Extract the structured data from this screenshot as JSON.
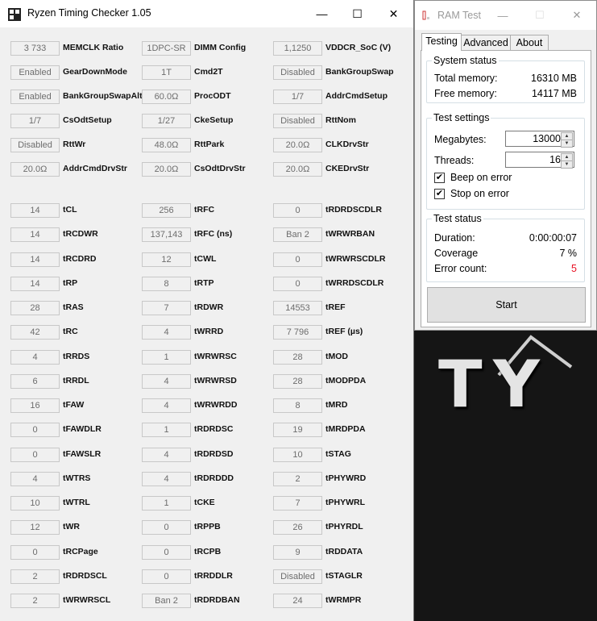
{
  "rtc": {
    "title": "Ryzen Timing Checker 1.05",
    "window_buttons": {
      "minimize": "—",
      "maximize": "☐",
      "close": "✕"
    },
    "columns": [
      [
        {
          "value": "3 733",
          "label": "MEMCLK Ratio"
        },
        {
          "value": "Enabled",
          "label": "GearDownMode"
        },
        {
          "value": "Enabled",
          "label": "BankGroupSwapAlt"
        },
        {
          "value": "1/7",
          "label": "CsOdtSetup"
        },
        {
          "value": "Disabled",
          "label": "RttWr"
        },
        {
          "value": "20.0Ω",
          "label": "AddrCmdDrvStr"
        },
        {
          "value": "14",
          "label": "tCL"
        },
        {
          "value": "14",
          "label": "tRCDWR"
        },
        {
          "value": "14",
          "label": "tRCDRD"
        },
        {
          "value": "14",
          "label": "tRP"
        },
        {
          "value": "28",
          "label": "tRAS"
        },
        {
          "value": "42",
          "label": "tRC"
        },
        {
          "value": "4",
          "label": "tRRDS"
        },
        {
          "value": "6",
          "label": "tRRDL"
        },
        {
          "value": "16",
          "label": "tFAW"
        },
        {
          "value": "0",
          "label": "tFAWDLR"
        },
        {
          "value": "0",
          "label": "tFAWSLR"
        },
        {
          "value": "4",
          "label": "tWTRS"
        },
        {
          "value": "10",
          "label": "tWTRL"
        },
        {
          "value": "12",
          "label": "tWR"
        },
        {
          "value": "0",
          "label": "tRCPage"
        },
        {
          "value": "2",
          "label": "tRDRDSCL"
        },
        {
          "value": "2",
          "label": "tWRWRSCL"
        }
      ],
      [
        {
          "value": "1DPC-SR",
          "label": "DIMM Config"
        },
        {
          "value": "1T",
          "label": "Cmd2T"
        },
        {
          "value": "60.0Ω",
          "label": "ProcODT"
        },
        {
          "value": "1/27",
          "label": "CkeSetup"
        },
        {
          "value": "48.0Ω",
          "label": "RttPark"
        },
        {
          "value": "20.0Ω",
          "label": "CsOdtDrvStr"
        },
        {
          "value": "256",
          "label": "tRFC"
        },
        {
          "value": "137,143",
          "label": "tRFC (ns)"
        },
        {
          "value": "12",
          "label": "tCWL"
        },
        {
          "value": "8",
          "label": "tRTP"
        },
        {
          "value": "7",
          "label": "tRDWR"
        },
        {
          "value": "4",
          "label": "tWRRD"
        },
        {
          "value": "1",
          "label": "tWRWRSC"
        },
        {
          "value": "4",
          "label": "tWRWRSD"
        },
        {
          "value": "4",
          "label": "tWRWRDD"
        },
        {
          "value": "1",
          "label": "tRDRDSC"
        },
        {
          "value": "4",
          "label": "tRDRDSD"
        },
        {
          "value": "4",
          "label": "tRDRDDD"
        },
        {
          "value": "1",
          "label": "tCKE"
        },
        {
          "value": "0",
          "label": "tRPPB"
        },
        {
          "value": "0",
          "label": "tRCPB"
        },
        {
          "value": "0",
          "label": "tRRDDLR"
        },
        {
          "value": "Ban 2",
          "label": "tRDRDBAN"
        }
      ],
      [
        {
          "value": "1,1250",
          "label": "VDDCR_SoC (V)"
        },
        {
          "value": "Disabled",
          "label": "BankGroupSwap"
        },
        {
          "value": "1/7",
          "label": "AddrCmdSetup"
        },
        {
          "value": "Disabled",
          "label": "RttNom"
        },
        {
          "value": "20.0Ω",
          "label": "CLKDrvStr"
        },
        {
          "value": "20.0Ω",
          "label": "CKEDrvStr"
        },
        {
          "value": "0",
          "label": "tRDRDSCDLR"
        },
        {
          "value": "Ban 2",
          "label": "tWRWRBAN"
        },
        {
          "value": "0",
          "label": "tWRWRSCDLR"
        },
        {
          "value": "0",
          "label": "tWRRDSCDLR"
        },
        {
          "value": "14553",
          "label": "tREF"
        },
        {
          "value": "7 796",
          "label": "tREF (µs)"
        },
        {
          "value": "28",
          "label": "tMOD"
        },
        {
          "value": "28",
          "label": "tMODPDA"
        },
        {
          "value": "8",
          "label": "tMRD"
        },
        {
          "value": "19",
          "label": "tMRDPDA"
        },
        {
          "value": "10",
          "label": "tSTAG"
        },
        {
          "value": "2",
          "label": "tPHYWRD"
        },
        {
          "value": "7",
          "label": "tPHYWRL"
        },
        {
          "value": "26",
          "label": "tPHYRDL"
        },
        {
          "value": "9",
          "label": "tRDDATA"
        },
        {
          "value": "Disabled",
          "label": "tSTAGLR"
        },
        {
          "value": "24",
          "label": "tWRMPR"
        }
      ]
    ]
  },
  "ramtest": {
    "title": "RAM Test",
    "window_buttons": {
      "minimize": "—",
      "maximize": "☐",
      "close": "✕"
    },
    "tabs": [
      "Testing",
      "Advanced",
      "About"
    ],
    "system_status": {
      "legend": "System status",
      "total_label": "Total memory:",
      "total_value": "16310 MB",
      "free_label": "Free memory:",
      "free_value": "14117 MB"
    },
    "test_settings": {
      "legend": "Test settings",
      "megabytes_label": "Megabytes:",
      "megabytes_value": "13000",
      "threads_label": "Threads:",
      "threads_value": "16",
      "beep_label": "Beep on error",
      "beep_checked": true,
      "stop_label": "Stop on error",
      "stop_checked": true
    },
    "test_status": {
      "legend": "Test status",
      "duration_label": "Duration:",
      "duration_value": "0:00:00:07",
      "coverage_label": "Coverage",
      "coverage_value": "7 %",
      "errors_label": "Error count:",
      "errors_value": "5"
    },
    "start_label": "Start",
    "colors": {
      "error": "#e81123"
    }
  },
  "desktop": {
    "logo_letters": [
      "T",
      "Y"
    ]
  }
}
